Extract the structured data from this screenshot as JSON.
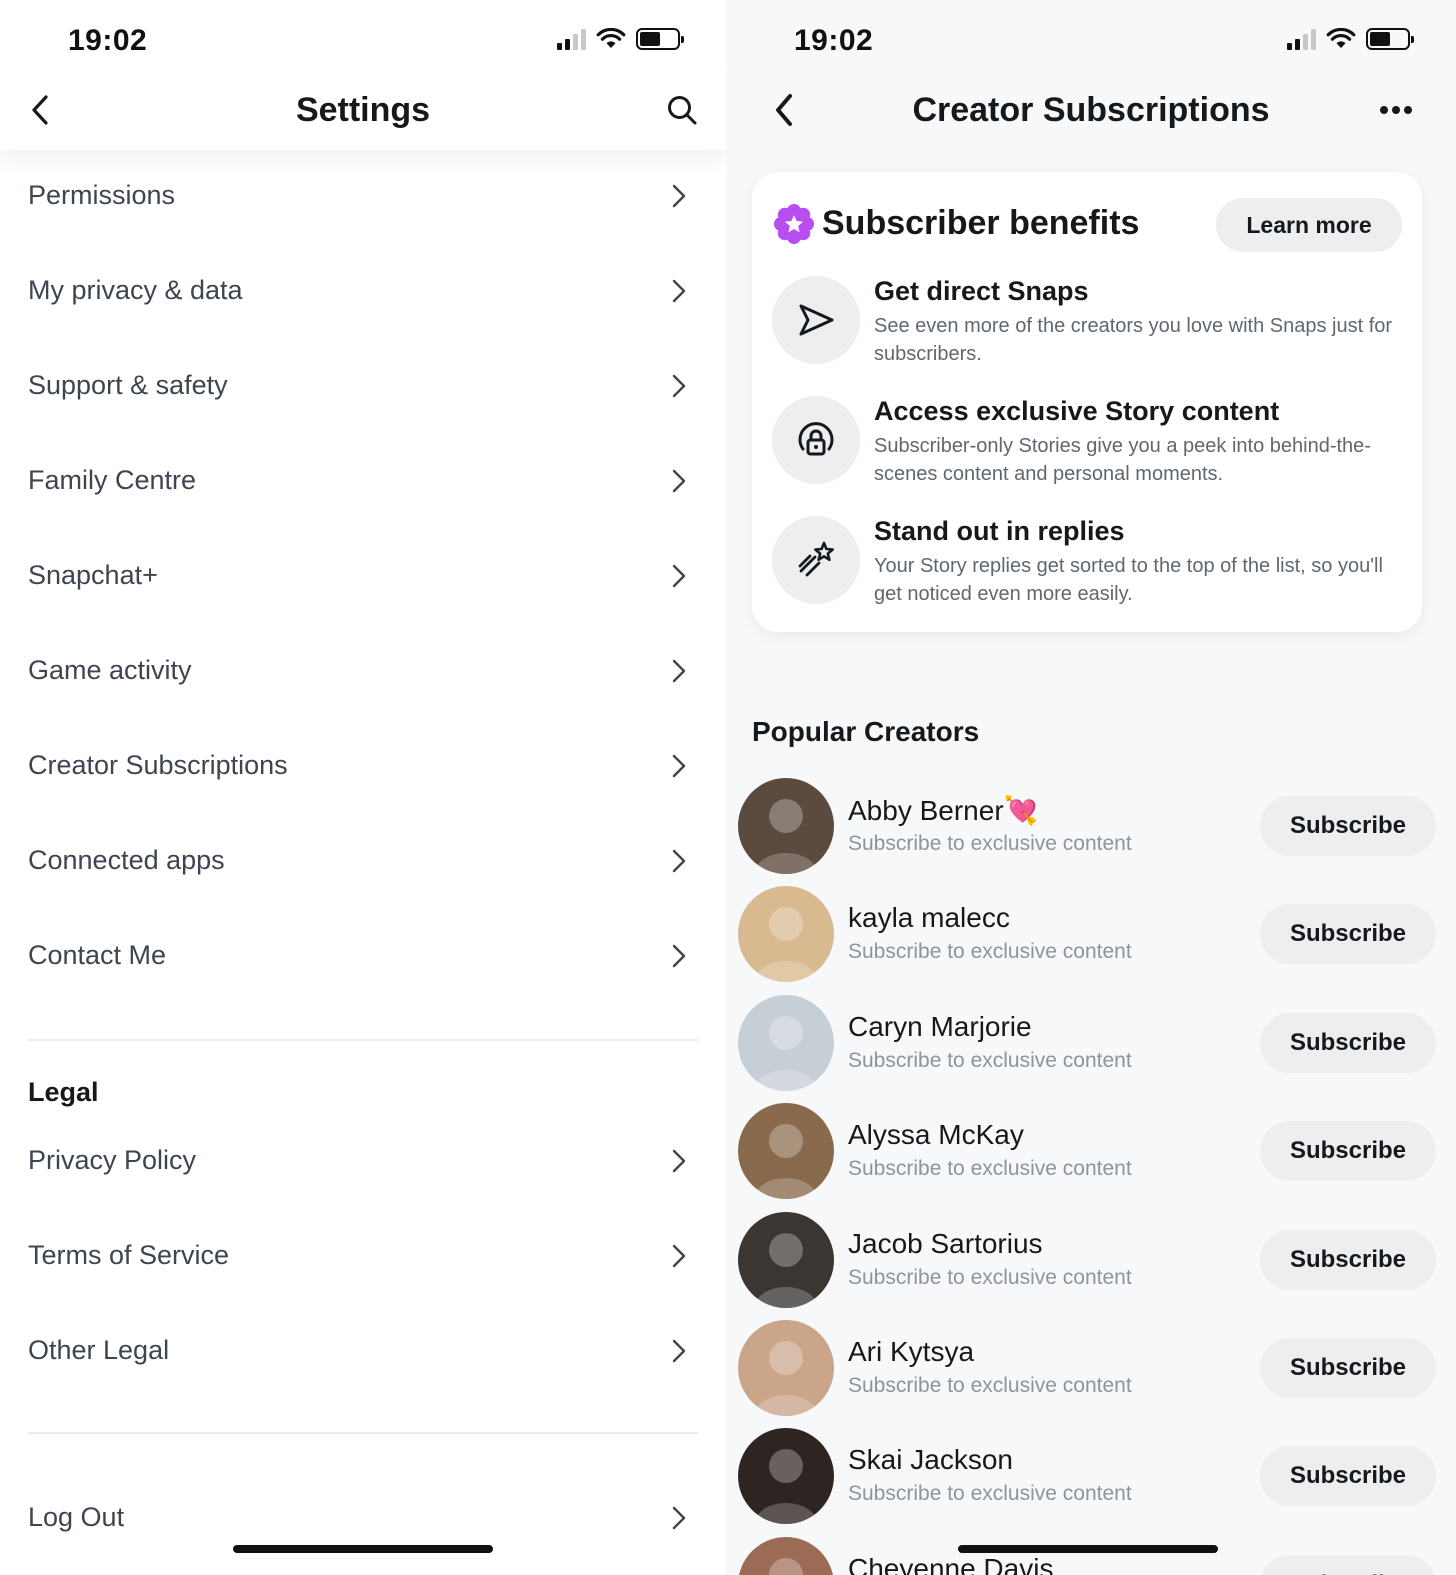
{
  "left": {
    "status": {
      "time": "19:02"
    },
    "header": {
      "title": "Settings",
      "back_icon": "chevron-left-icon",
      "search_icon": "search-icon"
    },
    "items": [
      {
        "label": "Permissions"
      },
      {
        "label": "My privacy & data"
      },
      {
        "label": "Support & safety"
      },
      {
        "label": "Family Centre"
      },
      {
        "label": "Snapchat+"
      },
      {
        "label": "Game activity"
      },
      {
        "label": "Creator Subscriptions"
      },
      {
        "label": "Connected apps"
      },
      {
        "label": "Contact Me"
      }
    ],
    "legal": {
      "title": "Legal",
      "items": [
        {
          "label": "Privacy Policy"
        },
        {
          "label": "Terms of Service"
        },
        {
          "label": "Other Legal"
        }
      ]
    },
    "logout": {
      "label": "Log Out"
    }
  },
  "right": {
    "status": {
      "time": "19:02"
    },
    "header": {
      "title": "Creator Subscriptions",
      "back_icon": "chevron-left-icon",
      "more_icon": "more-dots-icon"
    },
    "benefits": {
      "title": "Subscriber benefits",
      "learn_more": "Learn more",
      "accent": "#b84df0",
      "items": [
        {
          "icon": "send-arrow-icon",
          "title": "Get direct Snaps",
          "desc": "See even more of the creators you love with Snaps just for subscribers."
        },
        {
          "icon": "lock-story-icon",
          "title": "Access exclusive Story content",
          "desc": "Subscriber-only Stories give you a peek into behind-the-scenes content and personal moments."
        },
        {
          "icon": "sparkle-star-icon",
          "title": "Stand out in replies",
          "desc": "Your Story replies get sorted to the top of the list, so you'll get noticed even more easily."
        }
      ]
    },
    "popular": {
      "title": "Popular Creators",
      "subscribe_label": "Subscribe",
      "creators": [
        {
          "name": "Abby Berner",
          "emoji": "💘",
          "subtitle": "Subscribe to exclusive content",
          "avatar_color": "#5b4a3e"
        },
        {
          "name": "kayla malecc",
          "emoji": "",
          "subtitle": "Subscribe to exclusive content",
          "avatar_color": "#d9b98f"
        },
        {
          "name": "Caryn Marjorie",
          "emoji": "",
          "subtitle": "Subscribe to exclusive content",
          "avatar_color": "#c7cfd6"
        },
        {
          "name": "Alyssa McKay",
          "emoji": "",
          "subtitle": "Subscribe to exclusive content",
          "avatar_color": "#8a6a4c"
        },
        {
          "name": "Jacob Sartorius",
          "emoji": "",
          "subtitle": "Subscribe to exclusive content",
          "avatar_color": "#3b3632"
        },
        {
          "name": "Ari Kytsya",
          "emoji": "",
          "subtitle": "Subscribe to exclusive content",
          "avatar_color": "#caa58a"
        },
        {
          "name": "Skai Jackson",
          "emoji": "",
          "subtitle": "Subscribe to exclusive content",
          "avatar_color": "#2e2522"
        },
        {
          "name": "Cheyenne Davis",
          "emoji": "",
          "subtitle": "",
          "avatar_color": "#9c6b55"
        }
      ]
    }
  }
}
